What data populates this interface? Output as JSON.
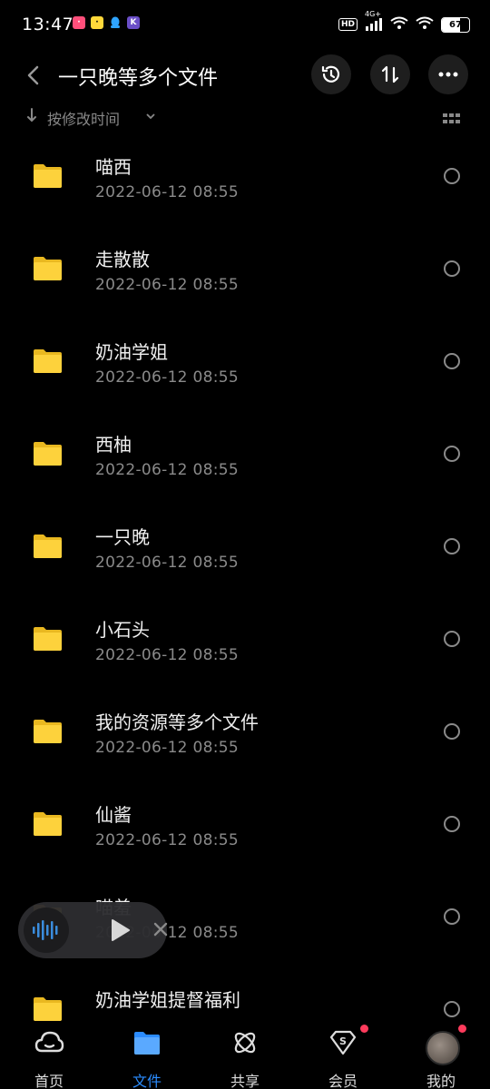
{
  "status_bar": {
    "time": "13:47",
    "hd": "HD",
    "network": "4G+",
    "battery": "67"
  },
  "header": {
    "title": "一只晚等多个文件"
  },
  "sort": {
    "label": "按修改时间"
  },
  "files": [
    {
      "name": "喵西",
      "date": "2022-06-12  08:55"
    },
    {
      "name": "走散散",
      "date": "2022-06-12  08:55"
    },
    {
      "name": "奶油学姐",
      "date": "2022-06-12  08:55"
    },
    {
      "name": "西柚",
      "date": "2022-06-12  08:55"
    },
    {
      "name": "一只晚",
      "date": "2022-06-12  08:55"
    },
    {
      "name": "小石头",
      "date": "2022-06-12  08:55"
    },
    {
      "name": "我的资源等多个文件",
      "date": "2022-06-12  08:55"
    },
    {
      "name": "仙酱",
      "date": "2022-06-12  08:55"
    },
    {
      "name": "喵羞",
      "date": "2022-06-12  08:55"
    },
    {
      "name": "奶油学姐提督福利",
      "date": ""
    }
  ],
  "bottom_nav": {
    "home": "首页",
    "files": "文件",
    "share": "共享",
    "vip": "会员",
    "mine": "我的"
  },
  "colors": {
    "accent": "#2b8cff",
    "folder": "#fdd23c",
    "badge": "#ff3b5c"
  }
}
